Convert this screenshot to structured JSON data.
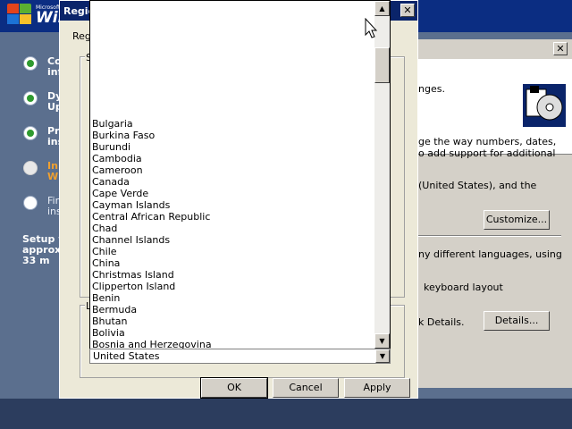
{
  "setup": {
    "brand_small": "Microsoft",
    "brand": "Win",
    "steps": [
      {
        "label": "Co\ninf",
        "state": "done"
      },
      {
        "label": "Dy\nUp",
        "state": "done"
      },
      {
        "label": "Pr\nins",
        "state": "done"
      },
      {
        "label": "In\nW",
        "state": "current"
      },
      {
        "label": "Fin\nins",
        "state": "pending"
      }
    ],
    "time_remaining": "Setup w\napprox\n33 m"
  },
  "regional_window": {
    "title": "Regio",
    "tab_label": "Reg",
    "group_label_1": "S",
    "group_label_2": "L",
    "help_button": "?",
    "close_button": "✕"
  },
  "right_dialog": {
    "close_button": "✕",
    "text_languages": "nges.",
    "text_numbers_1": "ge the way numbers, dates,",
    "text_numbers_2": "o add support for additional",
    "text_locale": "(United States), and the",
    "customize_button": "Customize...",
    "text_multi_1": "ny different languages, using",
    "text_keyboard": "keyboard layout",
    "text_details": "k Details.",
    "details_button": "Details..."
  },
  "country_list": {
    "items": [
      "Bulgaria",
      "Burkina Faso",
      "Burundi",
      "Cambodia",
      "Cameroon",
      "Canada",
      "Cape Verde",
      "Cayman Islands",
      "Central African Republic",
      "Chad",
      "Channel Islands",
      "Chile",
      "China",
      "Christmas Island",
      "Clipperton Island",
      "Benin",
      "Bermuda",
      "Bhutan",
      "Bolivia",
      "Bosnia and Herzegovina"
    ],
    "selected_value": "United States",
    "scroll_up": "▲",
    "scroll_down": "▼",
    "combo_arrow": "▼"
  },
  "footer_buttons": {
    "ok": "OK",
    "cancel": "Cancel",
    "apply": "Apply"
  },
  "colors": {
    "setup_blue": "#0b2d82",
    "titlebar": "#0a246a",
    "window_face": "#ece9d8",
    "step_done": "#2f9a2f",
    "step_current_text": "#f0a030"
  }
}
